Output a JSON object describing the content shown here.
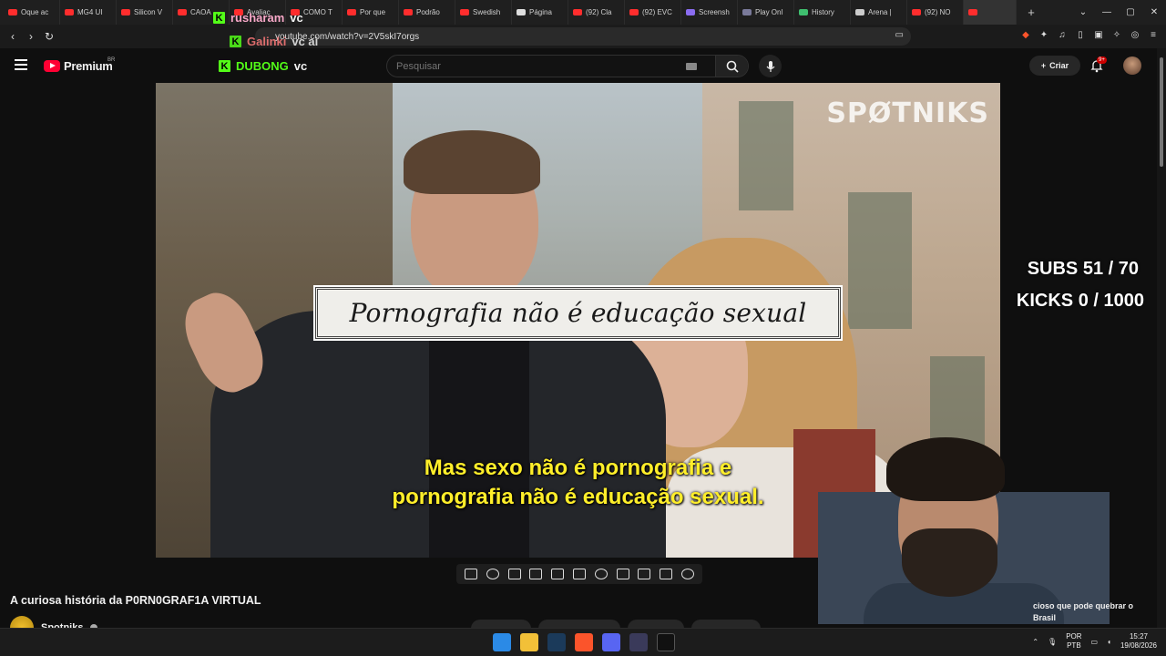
{
  "browser": {
    "tabs": [
      {
        "label": "Oque ac",
        "color": "#ff2d2d"
      },
      {
        "label": "MG4 UI",
        "color": "#ff2d2d"
      },
      {
        "label": "Silicon V",
        "color": "#ff2d2d"
      },
      {
        "label": "CAOA",
        "color": "#ff2d2d"
      },
      {
        "label": "Avaliaç",
        "color": "#ff2d2d"
      },
      {
        "label": "COMO T",
        "color": "#ff2d2d"
      },
      {
        "label": "Por que",
        "color": "#ff2d2d"
      },
      {
        "label": "Podrão",
        "color": "#ff2d2d"
      },
      {
        "label": "Swedish",
        "color": "#ff2d2d"
      },
      {
        "label": "Página",
        "color": "#dddddd"
      },
      {
        "label": "(92) Cla",
        "color": "#ff2d2d"
      },
      {
        "label": "(92) EVC",
        "color": "#ff2d2d"
      },
      {
        "label": "Screensh",
        "color": "#8a6cf0"
      },
      {
        "label": "Play Onl",
        "color": "#7a7a9a"
      },
      {
        "label": "History",
        "color": "#3fbf6f"
      },
      {
        "label": "Arena |",
        "color": "#cccccc"
      },
      {
        "label": "(92) NO",
        "color": "#ff2d2d"
      },
      {
        "label": "",
        "color": "#ff2d2d"
      }
    ],
    "url": "youtube.com/watch?v=2V5skI7orgs"
  },
  "overlay_chat": [
    {
      "user": "rusharam",
      "suffix": "vc"
    },
    {
      "user": "Galinki",
      "suffix": "vc ai"
    },
    {
      "user": "DUBONG",
      "suffix": "vc"
    }
  ],
  "youtube": {
    "brand": "Premium",
    "region": "BR",
    "search_placeholder": "Pesquisar",
    "create_label": "Criar",
    "notif_count": "9+"
  },
  "video": {
    "watermark": "SPØTNIKS",
    "title_card": "Pornografia não é educação sexual",
    "subtitle_line1": "Mas sexo não é pornografia e",
    "subtitle_line2": "pornografia não é educação sexual.",
    "title": "A curiosa história da P0RN0GRAF1A VIRTUAL",
    "channel": "Spotniks"
  },
  "stream": {
    "subs": "SUBS 51 / 70",
    "kicks": "KICKS 0 / 1000",
    "side_note": "cioso que pode quebrar o Brasil"
  },
  "taskbar": {
    "lang_top": "POR",
    "lang_bottom": "PTB",
    "time": "15:27",
    "date": "19/08/2026"
  },
  "colors": {
    "kick_green": "#53fc18",
    "subtitle_yellow": "#ffee2a",
    "yt_red": "#ff0033"
  }
}
